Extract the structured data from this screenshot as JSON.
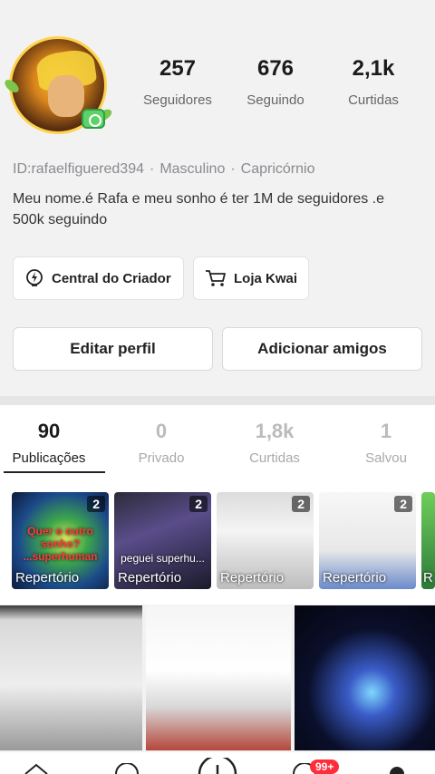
{
  "profile": {
    "stats": [
      {
        "value": "257",
        "label": "Seguidores"
      },
      {
        "value": "676",
        "label": "Seguindo"
      },
      {
        "value": "2,1k",
        "label": "Curtidas"
      }
    ],
    "id_text": "ID:rafaelfiguered394",
    "gender": "Masculino",
    "sign": "Capricórnio",
    "separator": "·",
    "bio": "Meu nome.é Rafa e meu sonho é ter 1M de seguidores .e 500k seguindo"
  },
  "quick_links": {
    "creator_center": "Central do Criador",
    "shop": "Loja Kwai"
  },
  "actions": {
    "edit_profile": "Editar perfil",
    "add_friends": "Adicionar amigos"
  },
  "tabs": [
    {
      "count": "90",
      "label": "Publicações"
    },
    {
      "count": "0",
      "label": "Privado"
    },
    {
      "count": "1,8k",
      "label": "Curtidas"
    },
    {
      "count": "1",
      "label": "Salvou"
    }
  ],
  "albums": [
    {
      "count": "2",
      "caption": "Repertório",
      "overlay": "Quer o outro sonho? ...superhuman"
    },
    {
      "count": "2",
      "caption": "Repertório",
      "overlay": "peguei superhu..."
    },
    {
      "count": "2",
      "caption": "Repertório",
      "overlay": ""
    },
    {
      "count": "2",
      "caption": "Repertório",
      "overlay": ""
    },
    {
      "count": "",
      "caption": "R",
      "overlay": ""
    }
  ],
  "bottom_nav": {
    "notification_badge": "99+"
  },
  "icons": [
    "creator-lightbulb-icon",
    "cart-icon",
    "home-icon",
    "discover-icon",
    "create-icon",
    "messages-icon",
    "profile-icon"
  ]
}
